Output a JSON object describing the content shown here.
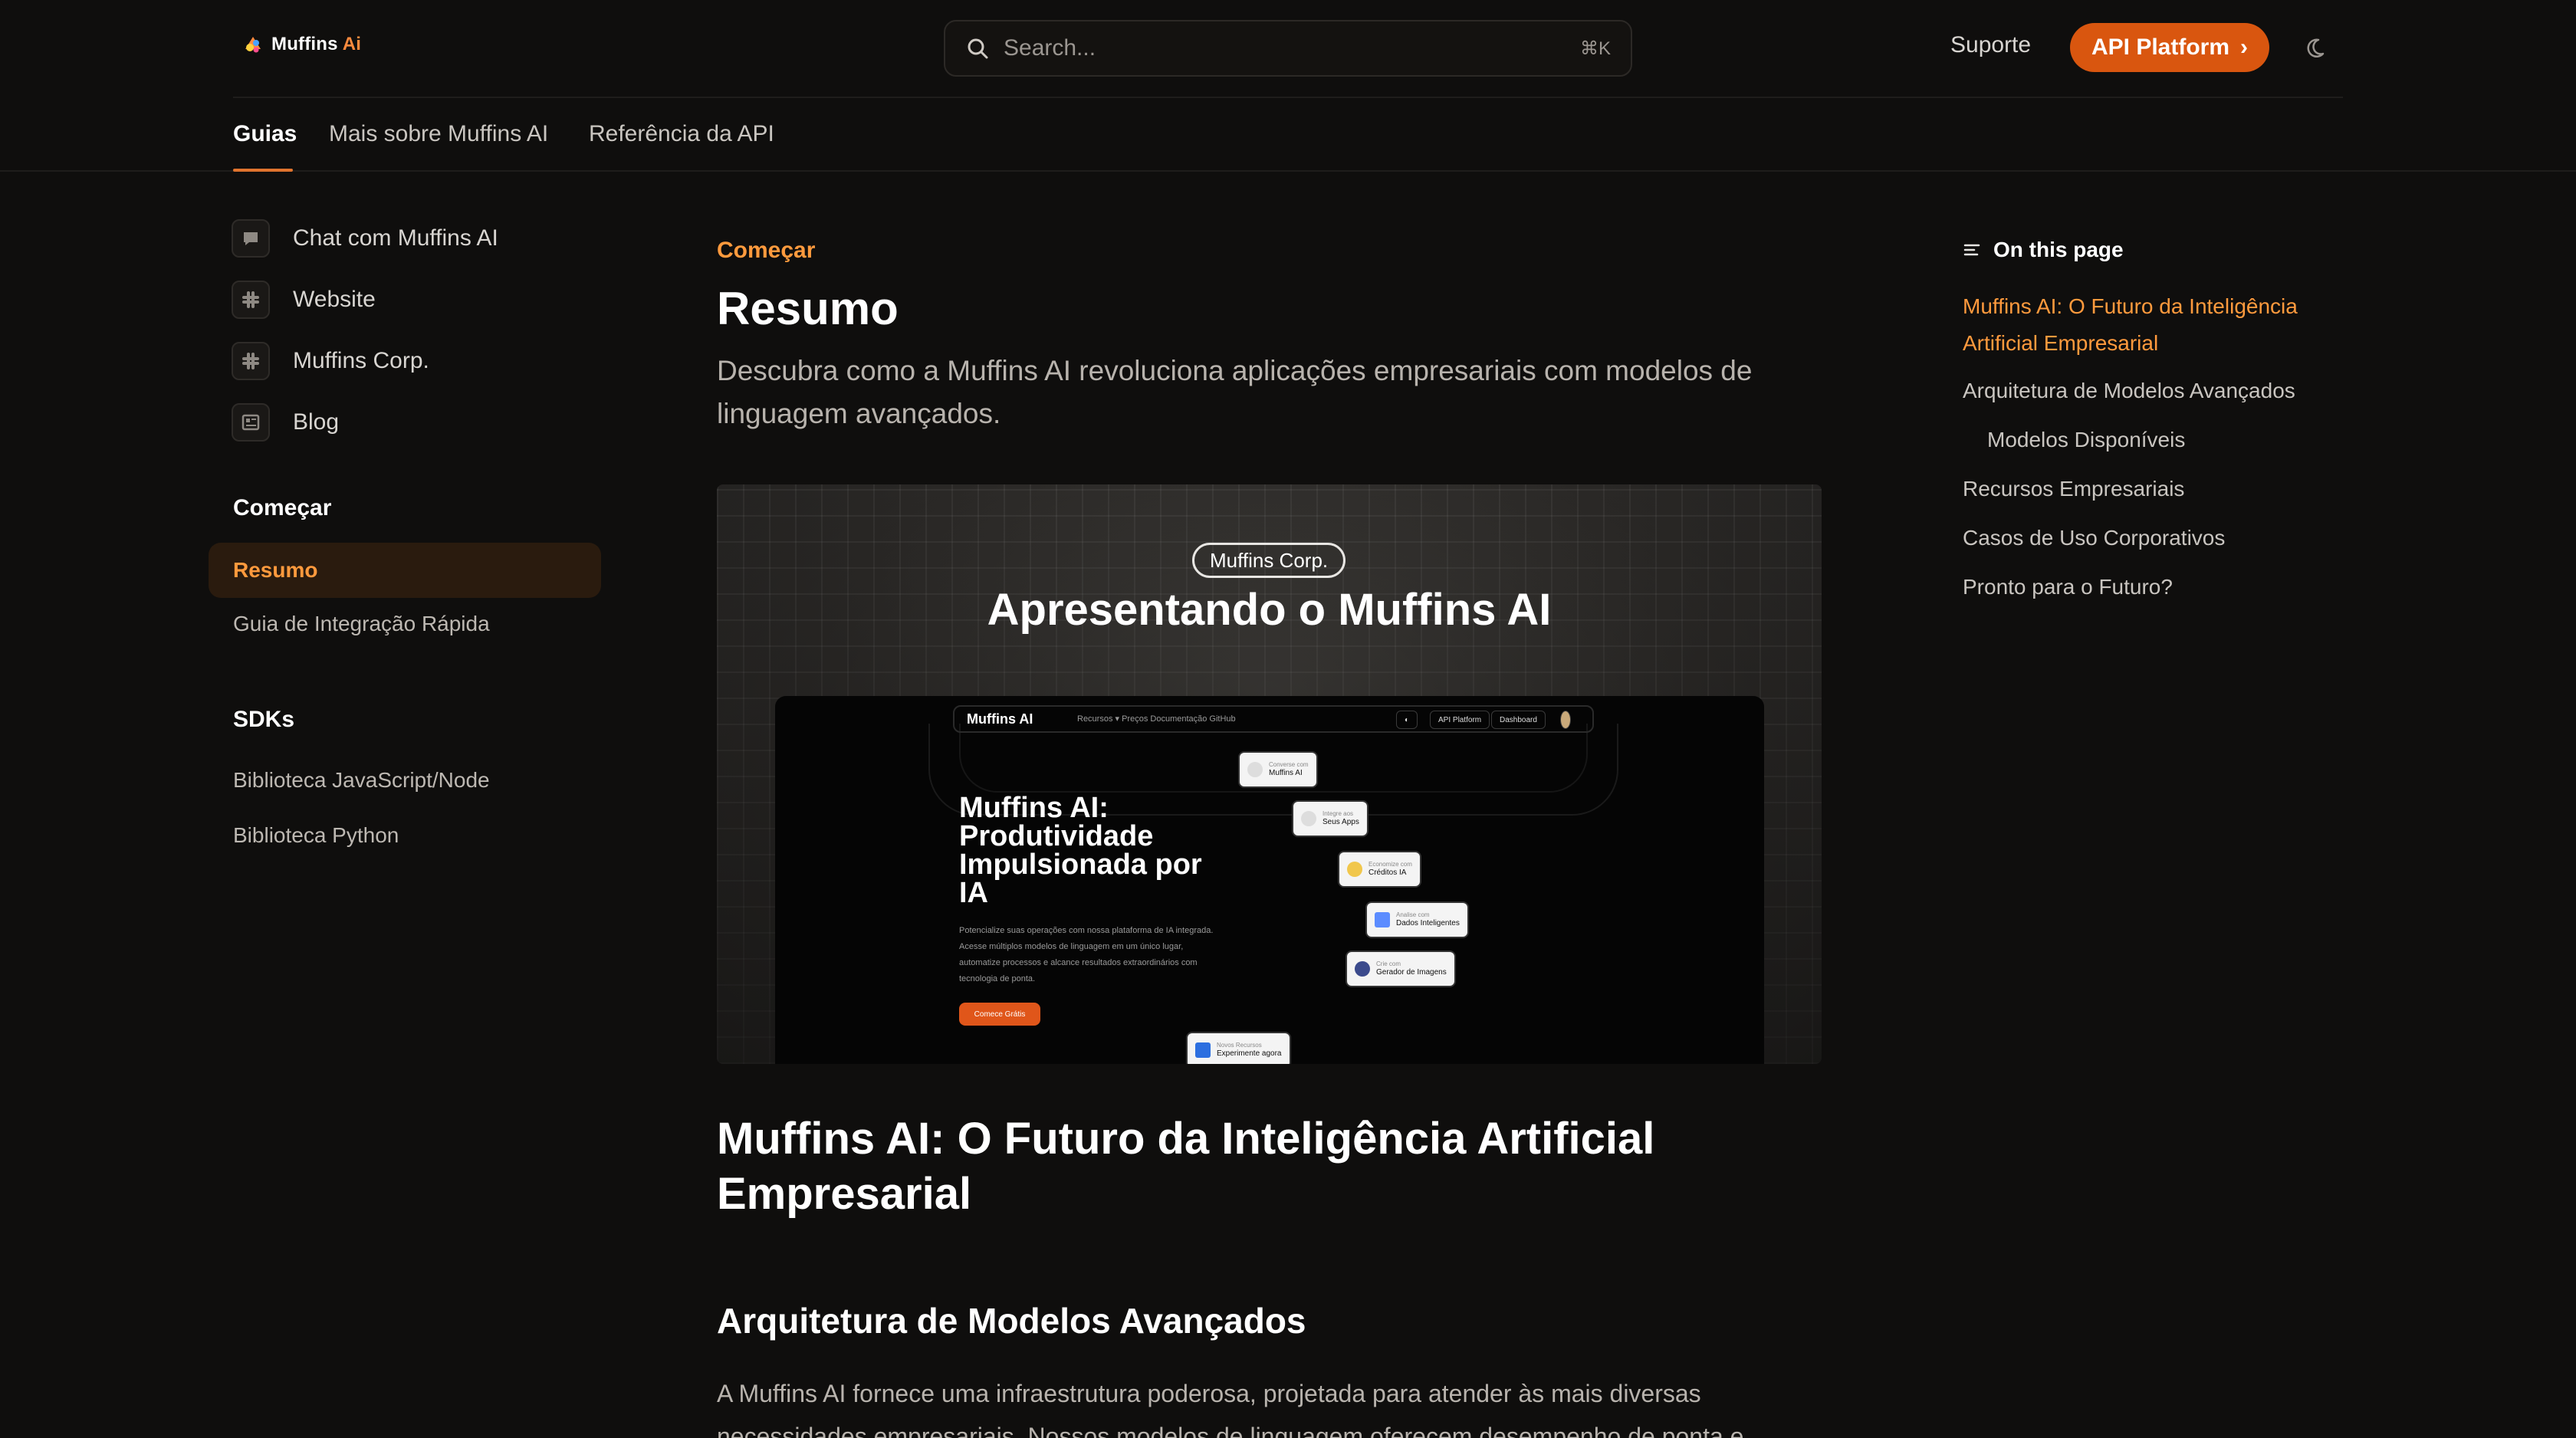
{
  "header": {
    "logo_text": "Muffins",
    "logo_ai": "Ai",
    "search_placeholder": "Search...",
    "search_shortcut": "⌘K",
    "support_label": "Suporte",
    "api_button_label": "API Platform",
    "api_button_chevron": "›"
  },
  "tabs": [
    {
      "label": "Guias",
      "active": true
    },
    {
      "label": "Mais sobre Muffins AI",
      "active": false
    },
    {
      "label": "Referência da API",
      "active": false
    }
  ],
  "sidebar": {
    "links": [
      {
        "label": "Chat com Muffins AI",
        "icon": "chat-icon"
      },
      {
        "label": "Website",
        "icon": "slack-icon"
      },
      {
        "label": "Muffins Corp.",
        "icon": "slack-icon"
      },
      {
        "label": "Blog",
        "icon": "newspaper-icon"
      }
    ],
    "sections": [
      {
        "title": "Começar",
        "items": [
          "Resumo",
          "Guia de Integração Rápida"
        ],
        "active": "Resumo"
      },
      {
        "title": "SDKs",
        "items": [
          "Biblioteca JavaScript/Node",
          "Biblioteca Python"
        ]
      }
    ]
  },
  "main": {
    "breadcrumb": "Começar",
    "title": "Resumo",
    "lead": "Descubra como a Muffins AI revoluciona aplicações empresariais com modelos de linguagem avançados.",
    "hero": {
      "pill": "Muffins Corp.",
      "title": "Apresentando o Muffins AI",
      "shot": {
        "brand": "Muffins AI",
        "links": "Recursos ▾   Preços   Documentação   GitHub",
        "chip_api": "API Platform",
        "chip_dashboard": "Dashboard",
        "headline": "Muffins AI: Produtividade Impulsionada por IA",
        "description": "Potencialize suas operações com nossa plataforma de IA integrada. Acesse múltiplos modelos de linguagem em um único lugar, automatize processos e alcance resultados extraordinários com tecnologia de ponta.",
        "cta": "Comece Grátis",
        "cards": [
          {
            "t1": "Converse com",
            "t2": "Muffins AI"
          },
          {
            "t1": "Integre aos",
            "t2": "Seus Apps"
          },
          {
            "t1": "Economize com",
            "t2": "Créditos IA"
          },
          {
            "t1": "Analise com",
            "t2": "Dados Inteligentes"
          },
          {
            "t1": "Crie com",
            "t2": "Gerador de Imagens"
          },
          {
            "t1": "Novos Recursos",
            "t2": "Experimente agora"
          }
        ]
      }
    },
    "h2": "Muffins AI: O Futuro da Inteligência Artificial Empresarial",
    "h3": "Arquitetura de Modelos Avançados",
    "paragraph": "A Muffins AI fornece uma infraestrutura poderosa, projetada para atender às mais diversas necessidades empresariais. Nossos modelos de linguagem oferecem desempenho de ponta e"
  },
  "toc": {
    "heading": "On this page",
    "items": [
      {
        "label": "Muffins AI: O Futuro da Inteligência Artificial Empresarial",
        "level": 1,
        "active": true
      },
      {
        "label": "Arquitetura de Modelos Avançados",
        "level": 1
      },
      {
        "label": "Modelos Disponíveis",
        "level": 2
      },
      {
        "label": "Recursos Empresariais",
        "level": 1
      },
      {
        "label": "Casos de Uso Corporativos",
        "level": 1
      },
      {
        "label": "Pronto para o Futuro?",
        "level": 1
      }
    ]
  },
  "colors": {
    "background": "#0f0e0d",
    "accent": "#ff9a3d",
    "button": "#d9560f"
  }
}
